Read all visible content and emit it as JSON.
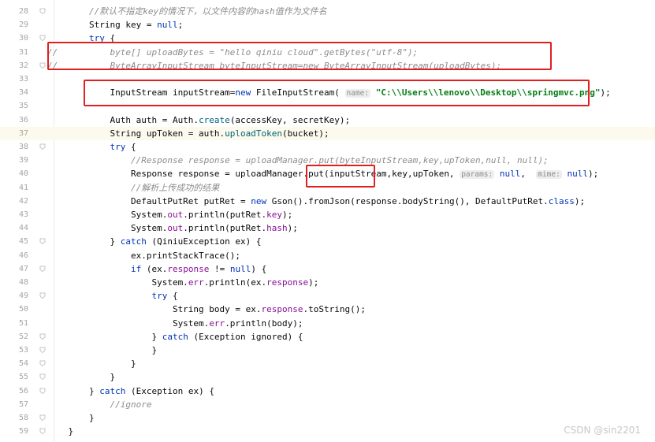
{
  "editor": {
    "lines": [
      {
        "num": "28",
        "segments": [
          [
            "cm",
            "        //默认不指定key的情况下，以文件内容的hash值作为文件名"
          ]
        ]
      },
      {
        "num": "29",
        "segments": [
          [
            "plain",
            "        String key = "
          ],
          [
            "kw",
            "null"
          ],
          [
            "plain",
            ";"
          ]
        ]
      },
      {
        "num": "30",
        "segments": [
          [
            "plain",
            "        "
          ],
          [
            "kw",
            "try"
          ],
          [
            "plain",
            " {"
          ]
        ]
      },
      {
        "num": "31",
        "segments": [
          [
            "cm",
            "//          byte[] uploadBytes = \"hello qiniu cloud\".getBytes(\"utf-8\");"
          ]
        ]
      },
      {
        "num": "32",
        "segments": [
          [
            "cm",
            "//          ByteArrayInputStream byteInputStream=new ByteArrayInputStream(uploadBytes);"
          ]
        ]
      },
      {
        "num": "33",
        "segments": []
      },
      {
        "num": "34",
        "segments": [
          [
            "plain",
            "            InputStream inputStream="
          ],
          [
            "kw",
            "new"
          ],
          [
            "plain",
            " FileInputStream( "
          ],
          [
            "hint",
            "name:"
          ],
          [
            "str",
            " \"C:\\\\Users\\\\lenovo\\\\Desktop\\\\springmvc.png\""
          ],
          [
            "plain",
            ");"
          ]
        ]
      },
      {
        "num": "35",
        "segments": []
      },
      {
        "num": "36",
        "segments": [
          [
            "plain",
            "            Auth auth = Auth."
          ],
          [
            "mth",
            "create"
          ],
          [
            "plain",
            "(accessKey, secretKey);"
          ]
        ]
      },
      {
        "num": "37",
        "segments": [
          [
            "plain",
            "            String upToken = auth."
          ],
          [
            "mth",
            "uploadToken"
          ],
          [
            "plain",
            "(bucket);"
          ]
        ]
      },
      {
        "num": "38",
        "segments": [
          [
            "plain",
            "            "
          ],
          [
            "kw",
            "try"
          ],
          [
            "plain",
            " {"
          ]
        ]
      },
      {
        "num": "39",
        "segments": [
          [
            "cm",
            "                //Response response = uploadManager.put(byteInputStream,key,upToken,null, null);"
          ]
        ]
      },
      {
        "num": "40",
        "segments": [
          [
            "plain",
            "                Response response = uploadManager.put(inputStream,key,upToken, "
          ],
          [
            "hint",
            "params:"
          ],
          [
            "kw",
            " null"
          ],
          [
            "plain",
            ",  "
          ],
          [
            "hint",
            "mime:"
          ],
          [
            "kw",
            " null"
          ],
          [
            "plain",
            ");"
          ]
        ]
      },
      {
        "num": "41",
        "segments": [
          [
            "cm",
            "                //解析上传成功的结果"
          ]
        ]
      },
      {
        "num": "42",
        "segments": [
          [
            "plain",
            "                DefaultPutRet putRet = "
          ],
          [
            "kw",
            "new"
          ],
          [
            "plain",
            " Gson().fromJson(response.bodyString(), DefaultPutRet."
          ],
          [
            "kw",
            "class"
          ],
          [
            "plain",
            ");"
          ]
        ]
      },
      {
        "num": "43",
        "segments": [
          [
            "plain",
            "                System."
          ],
          [
            "field",
            "out"
          ],
          [
            "plain",
            ".println(putRet."
          ],
          [
            "field",
            "key"
          ],
          [
            "plain",
            ");"
          ]
        ]
      },
      {
        "num": "44",
        "segments": [
          [
            "plain",
            "                System."
          ],
          [
            "field",
            "out"
          ],
          [
            "plain",
            ".println(putRet."
          ],
          [
            "field",
            "hash"
          ],
          [
            "plain",
            ");"
          ]
        ]
      },
      {
        "num": "45",
        "segments": [
          [
            "plain",
            "            } "
          ],
          [
            "kw",
            "catch"
          ],
          [
            "plain",
            " (QiniuException ex) {"
          ]
        ]
      },
      {
        "num": "46",
        "segments": [
          [
            "plain",
            "                ex.printStackTrace();"
          ]
        ]
      },
      {
        "num": "47",
        "segments": [
          [
            "plain",
            "                "
          ],
          [
            "kw",
            "if"
          ],
          [
            "plain",
            " (ex."
          ],
          [
            "field",
            "response"
          ],
          [
            "plain",
            " != "
          ],
          [
            "kw",
            "null"
          ],
          [
            "plain",
            ") {"
          ]
        ]
      },
      {
        "num": "48",
        "segments": [
          [
            "plain",
            "                    System."
          ],
          [
            "field",
            "err"
          ],
          [
            "plain",
            ".println(ex."
          ],
          [
            "field",
            "response"
          ],
          [
            "plain",
            ");"
          ]
        ]
      },
      {
        "num": "49",
        "segments": [
          [
            "plain",
            "                    "
          ],
          [
            "kw",
            "try"
          ],
          [
            "plain",
            " {"
          ]
        ]
      },
      {
        "num": "50",
        "segments": [
          [
            "plain",
            "                        String body = ex."
          ],
          [
            "field",
            "response"
          ],
          [
            "plain",
            ".toString();"
          ]
        ]
      },
      {
        "num": "51",
        "segments": [
          [
            "plain",
            "                        System."
          ],
          [
            "field",
            "err"
          ],
          [
            "plain",
            ".println(body);"
          ]
        ]
      },
      {
        "num": "52",
        "segments": [
          [
            "plain",
            "                    } "
          ],
          [
            "kw",
            "catch"
          ],
          [
            "plain",
            " (Exception ignored) {"
          ]
        ]
      },
      {
        "num": "53",
        "segments": [
          [
            "plain",
            "                    }"
          ]
        ]
      },
      {
        "num": "54",
        "segments": [
          [
            "plain",
            "                }"
          ]
        ]
      },
      {
        "num": "55",
        "segments": [
          [
            "plain",
            "            }"
          ]
        ]
      },
      {
        "num": "56",
        "segments": [
          [
            "plain",
            "        } "
          ],
          [
            "kw",
            "catch"
          ],
          [
            "plain",
            " (Exception ex) {"
          ]
        ]
      },
      {
        "num": "57",
        "segments": [
          [
            "cm",
            "            //ignore"
          ]
        ]
      },
      {
        "num": "58",
        "segments": [
          [
            "plain",
            "        }"
          ]
        ]
      },
      {
        "num": "59",
        "segments": [
          [
            "plain",
            "    }"
          ]
        ]
      }
    ]
  },
  "watermark": "CSDN @sin2201",
  "colors": {
    "keyword": "#0033b3",
    "comment": "#8c8c8c",
    "string": "#067d17",
    "field": "#871094",
    "method": "#00627a",
    "annotation_box": "#e0201f"
  }
}
